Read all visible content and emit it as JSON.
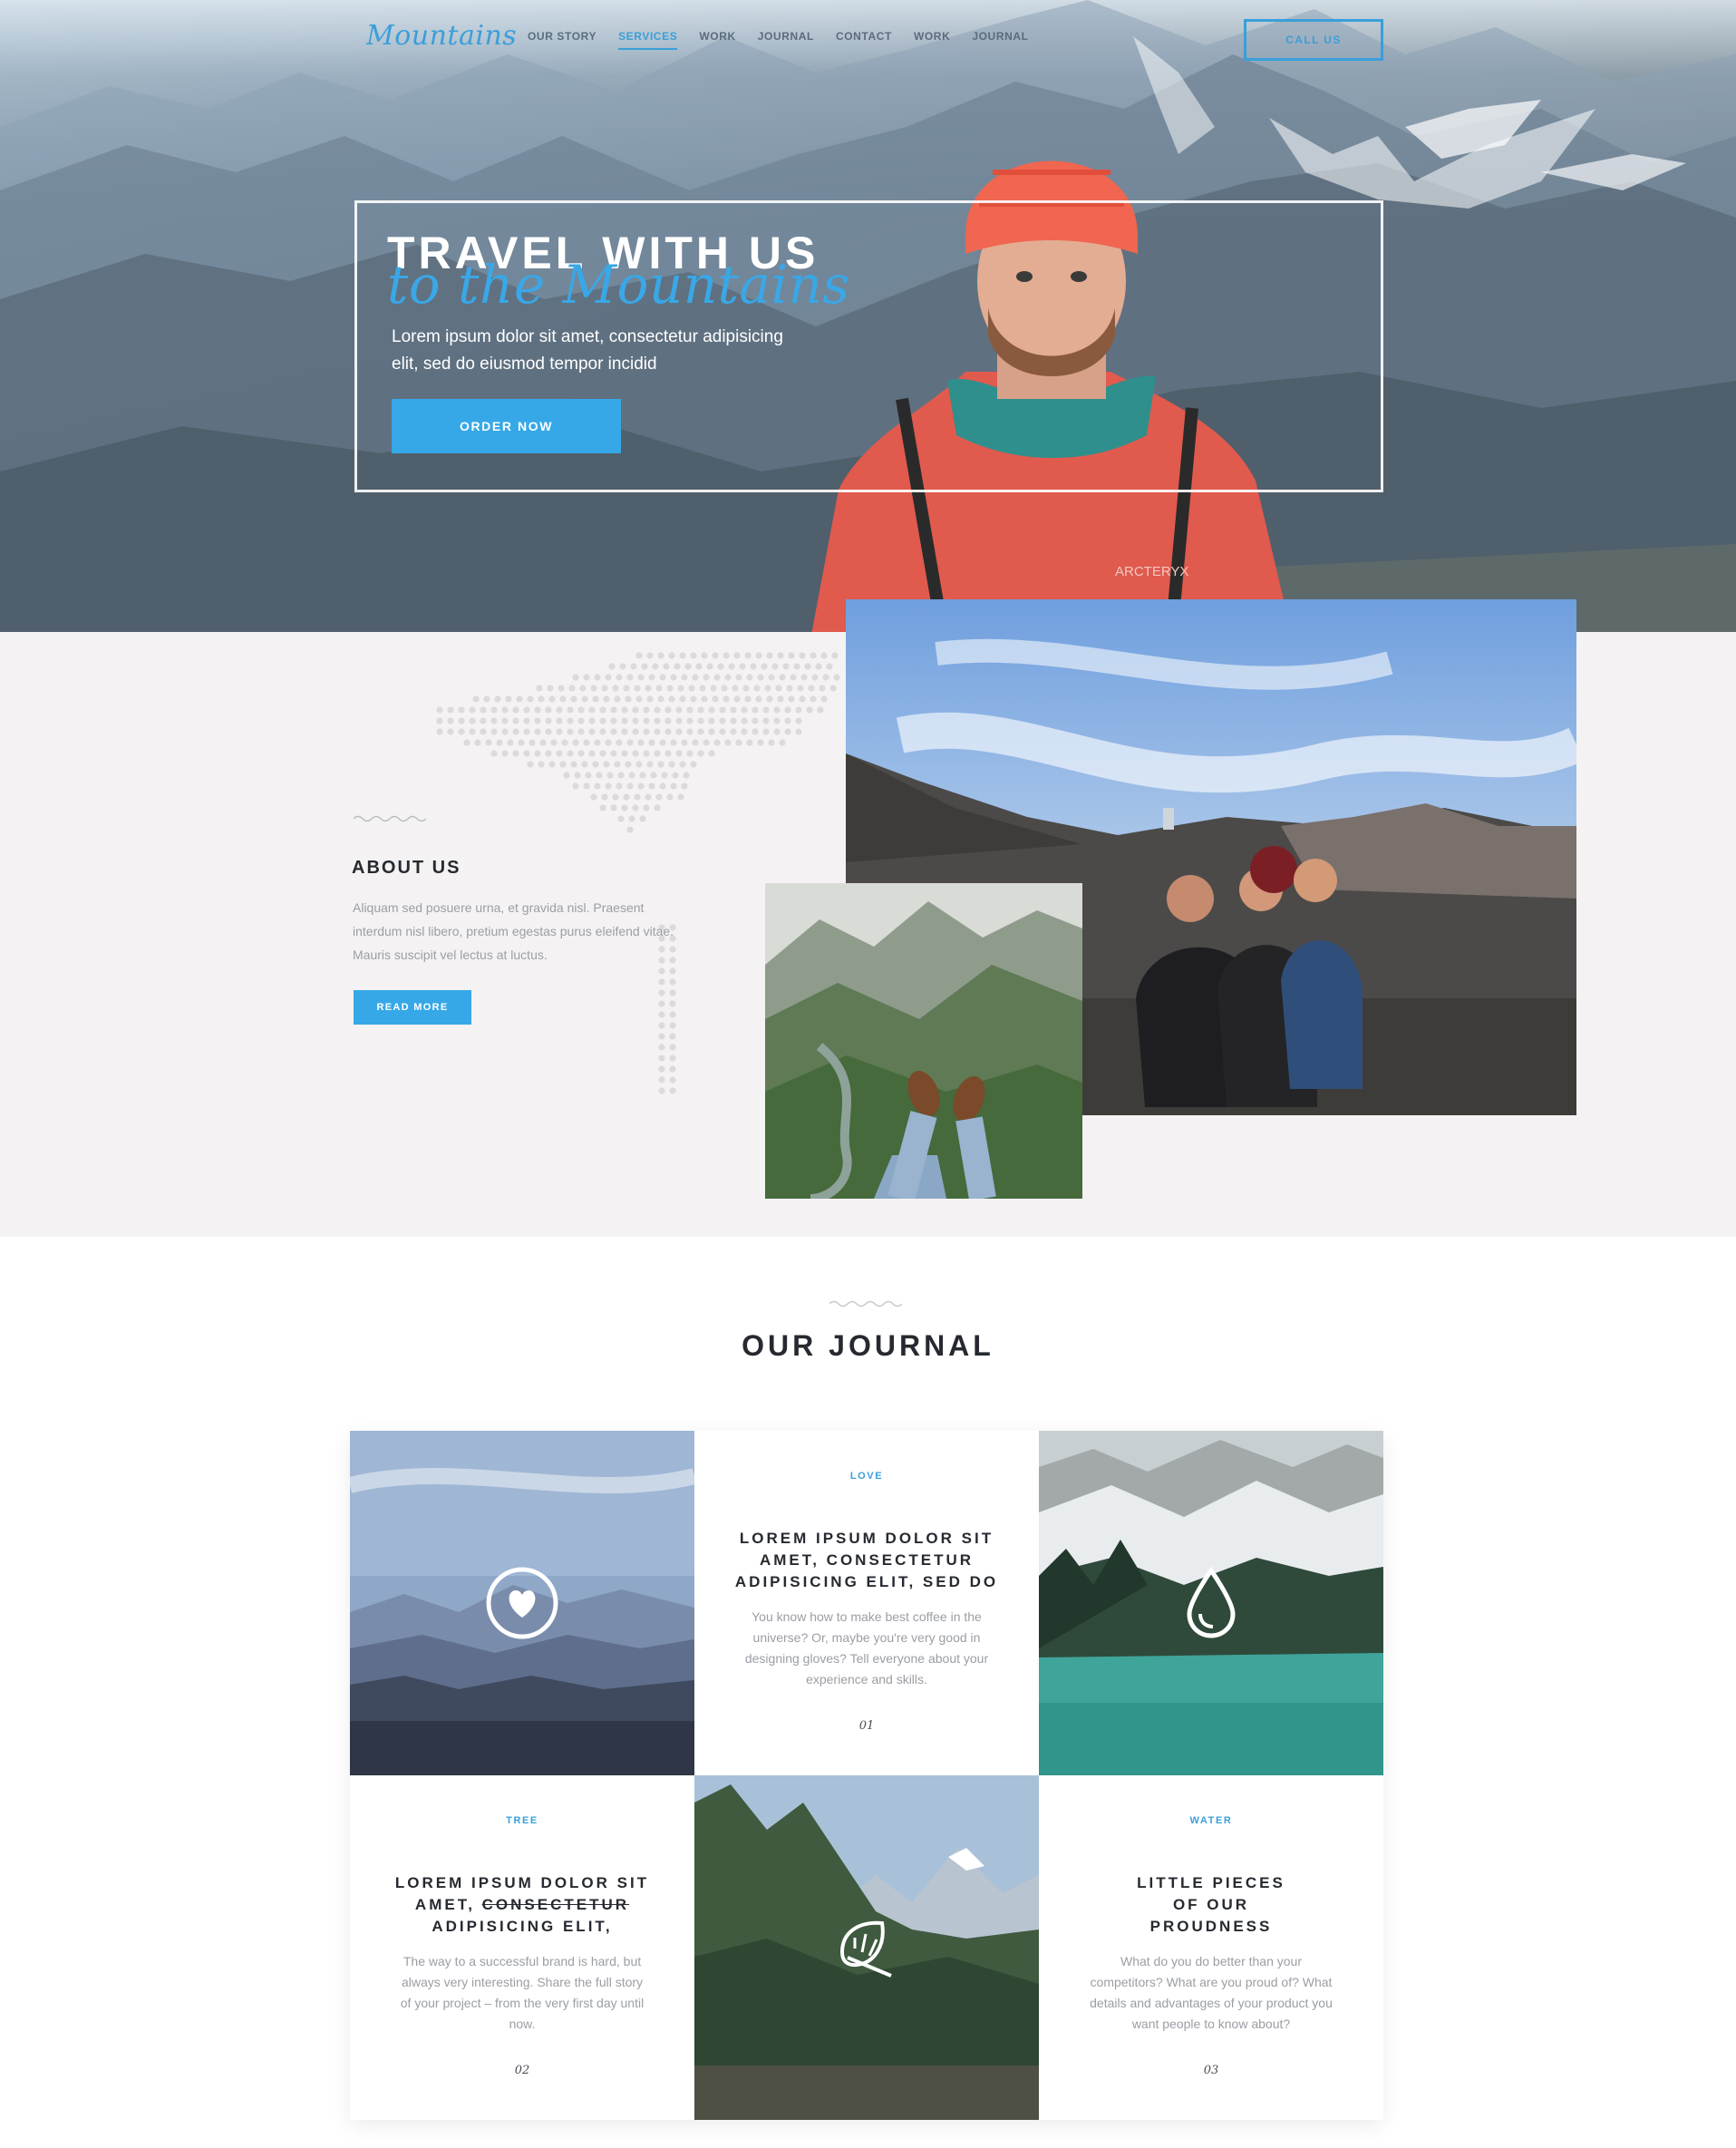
{
  "brand": {
    "logo": "Mountains",
    "accent": "#36a8e8"
  },
  "nav": {
    "items": [
      "OUR STORY",
      "SERVICES",
      "WORK",
      "JOURNAL",
      "CONTACT",
      "WORK",
      "JOURNAL"
    ],
    "active_index": 1,
    "call_label": "CALL US"
  },
  "hero": {
    "title": "TRAVEL WITH US",
    "script": "to the Mountains",
    "text": "Lorem ipsum dolor sit amet, consectetur adipisicing elit, sed do eiusmod tempor incidid",
    "button": "ORDER NOW"
  },
  "about": {
    "title": "ABOUT US",
    "text": "Aliquam sed posuere urna, et gravida nisl. Praesent interdum nisl libero, pretium egestas purus eleifend vitae. Mauris suscipit vel lectus at luctus.",
    "button": "READ MORE"
  },
  "journal": {
    "title": "OUR JOURNAL",
    "cards": [
      {
        "tag": "LOVE",
        "title": "LOREM IPSUM DOLOR SIT AMET, CONSECTETUR ADIPISICING ELIT, SED DO",
        "body": "You know how to make best coffee in the universe? Or, maybe you're very good in designing gloves? Tell everyone about your experience and skills.",
        "num": "01"
      },
      {
        "tag": "TREE",
        "title_a": "LOREM IPSUM DOLOR SIT AMET,",
        "title_strike": "CONSECTETUR",
        "title_b": "ADIPISICING ELIT,",
        "body": "The way to a successful brand is hard, but always very interesting. Share the full story of your project – from the very first day until now.",
        "num": "02"
      },
      {
        "tag": "WATER",
        "title": "LITTLE PIECES OF OUR PROUDNESS",
        "body": "What do you do better than your competitors? What are you proud of? What details and advantages of your product you want people to know about?",
        "num": "03"
      }
    ],
    "icons": [
      "heart-icon",
      "water-drop-icon",
      "leaf-icon"
    ]
  }
}
